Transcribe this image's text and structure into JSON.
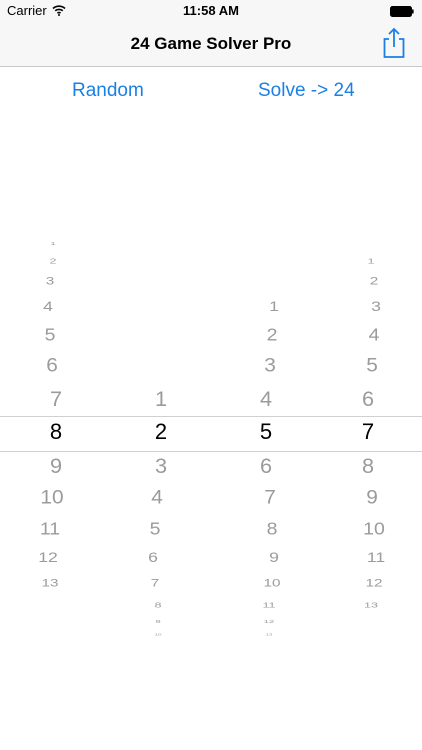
{
  "status_bar": {
    "carrier": "Carrier",
    "time": "11:58 AM",
    "wifi_icon": "wifi-icon",
    "battery_icon": "battery-icon"
  },
  "nav": {
    "title": "24 Game Solver Pro",
    "share_icon": "share-icon"
  },
  "actions": {
    "random_label": "Random",
    "solve_label": "Solve -> 24"
  },
  "colors": {
    "accent": "#1a80e6",
    "inactive_text": "#9b9b9b",
    "selected_text": "#000000"
  },
  "pickers": [
    {
      "name": "picker-number-1",
      "items": [
        "1",
        "2",
        "3",
        "4",
        "5",
        "6",
        "7",
        "8",
        "9",
        "10",
        "11",
        "12",
        "13"
      ],
      "selected": "8"
    },
    {
      "name": "picker-number-2",
      "items": [
        "1",
        "2",
        "3",
        "4",
        "5",
        "6",
        "7",
        "8",
        "9",
        "10"
      ],
      "selected": "2"
    },
    {
      "name": "picker-number-3",
      "items": [
        "1",
        "2",
        "3",
        "4",
        "5",
        "6",
        "7",
        "8",
        "9",
        "10",
        "11",
        "12",
        "13"
      ],
      "selected": "5"
    },
    {
      "name": "picker-number-4",
      "items": [
        "1",
        "2",
        "3",
        "4",
        "5",
        "6",
        "7",
        "8",
        "9",
        "10",
        "11",
        "12",
        "13"
      ],
      "selected": "7"
    }
  ]
}
